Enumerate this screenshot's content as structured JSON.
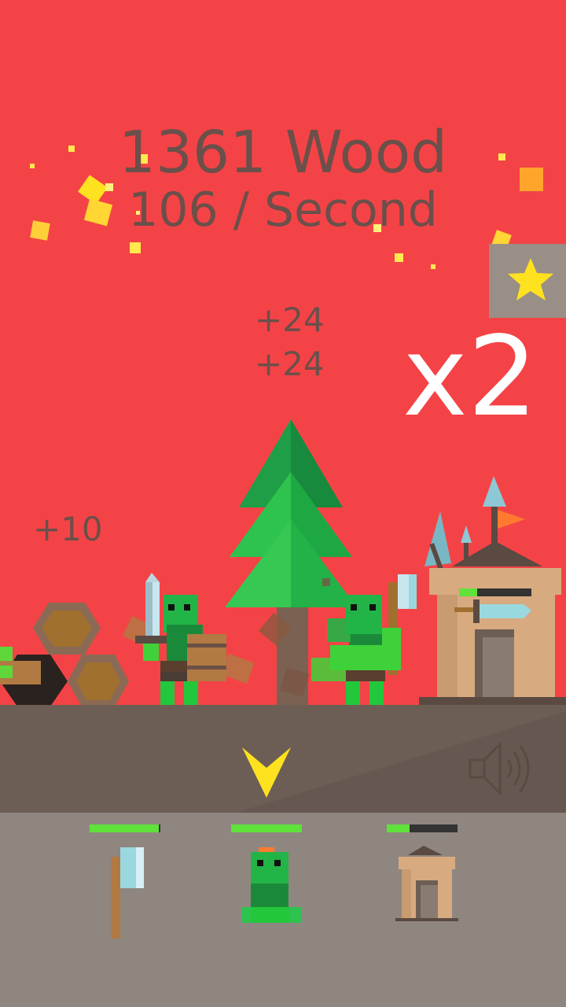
{
  "resources": {
    "wood_label": "1361 Wood",
    "rate_label": "106 / Second"
  },
  "floating_gains": [
    "+24",
    "+24",
    "+10"
  ],
  "multiplier": "x2",
  "colors": {
    "background": "#f44346",
    "text": "#6b4f4a",
    "ground": "#6d5e55",
    "shop": "#8f8680",
    "bar_fill": "#5fe23a",
    "star": "#ffe21f"
  },
  "icons": {
    "star_button": "star-icon",
    "dropdown": "chevron-down-icon",
    "sound": "speaker-icon"
  },
  "tower_health_fraction": 0.25,
  "shop": {
    "items": [
      {
        "name": "axe",
        "icon": "axe-icon",
        "progress": 0.98
      },
      {
        "name": "orc",
        "icon": "orc-icon",
        "progress": 1.0
      },
      {
        "name": "tower",
        "icon": "tower-icon",
        "progress": 0.32
      }
    ]
  }
}
